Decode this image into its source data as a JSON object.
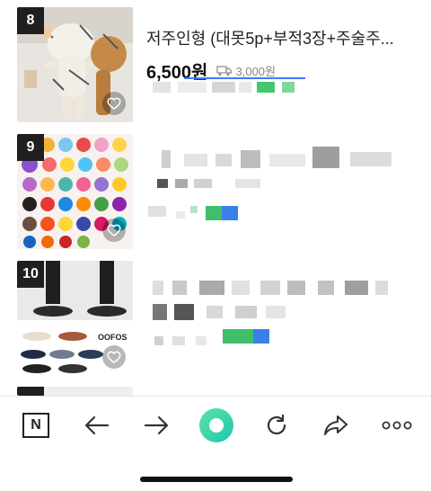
{
  "items": [
    {
      "rank": "8",
      "title": "저주인형 (대못5p+부적3장+주술주...",
      "price": "6,500원",
      "shipping": "3,000원"
    },
    {
      "rank": "9"
    },
    {
      "rank": "10"
    }
  ],
  "icons": {
    "heart": "heart-icon",
    "naver": "naver-n-icon",
    "back": "back-arrow-icon",
    "forward": "forward-arrow-icon",
    "home": "green-home-circle-icon",
    "refresh": "refresh-icon",
    "share": "share-icon",
    "more": "more-dots-icon",
    "truck": "truck-icon"
  },
  "toolbar": {
    "naver_label": "N"
  },
  "colors": {
    "accent_green": "#2fd38a",
    "accent_blue": "#3a7bff",
    "rank_bg": "#1f1f1f"
  }
}
